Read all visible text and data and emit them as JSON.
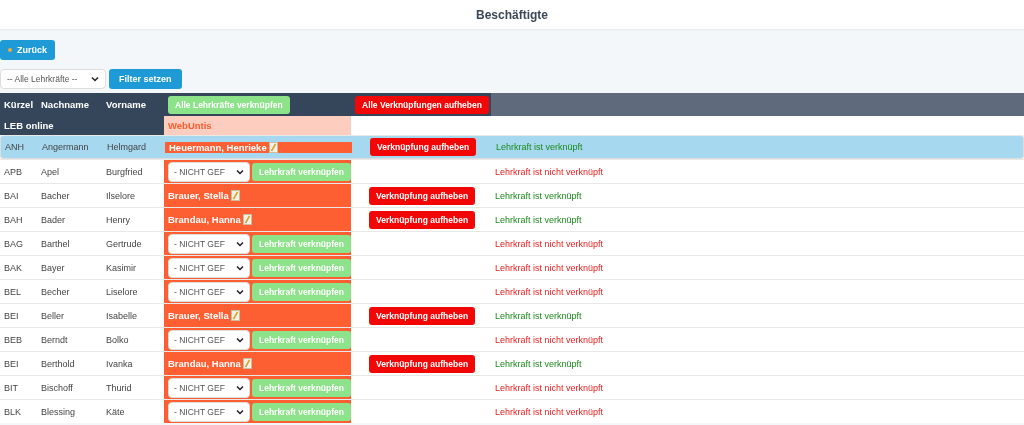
{
  "page_title": "Beschäftigte",
  "back_button": "Zurück",
  "filter": {
    "select_value": "-- Alle Lehrkräfte --",
    "button": "Filter setzen"
  },
  "table": {
    "columns": [
      "Kürzel",
      "Nachname",
      "Vorname"
    ],
    "link_all_button": "Alle Lehrkräfte verknüpfen",
    "unlink_all_button": "Alle Verknüpfungen aufheben",
    "source_label": "LEB online",
    "target_label": "WebUntis",
    "rows": [
      {
        "code": "ANH",
        "last_name": "Angermann",
        "first_name": "Helmgard",
        "selected": true,
        "linked": true,
        "webuntis_name": "Heuermann, Henrieke",
        "action": "Verknüpfung aufheben",
        "status": "Lehrkraft ist verknüpft"
      },
      {
        "code": "APB",
        "last_name": "Apel",
        "first_name": "Burgfried",
        "selected": false,
        "linked": false,
        "select_value": "- NICHT GEF",
        "action": "Lehrkraft verknüpfen",
        "status": "Lehrkraft ist nicht verknüpft"
      },
      {
        "code": "BAI",
        "last_name": "Bacher",
        "first_name": "Ilselore",
        "selected": false,
        "linked": true,
        "webuntis_name": "Brauer, Stella",
        "action": "Verknüpfung aufheben",
        "status": "Lehrkraft ist verknüpft"
      },
      {
        "code": "BAH",
        "last_name": "Bader",
        "first_name": "Henry",
        "selected": false,
        "linked": true,
        "webuntis_name": "Brandau, Hanna",
        "action": "Verknüpfung aufheben",
        "status": "Lehrkraft ist verknüpft"
      },
      {
        "code": "BAG",
        "last_name": "Barthel",
        "first_name": "Gertrude",
        "selected": false,
        "linked": false,
        "select_value": "- NICHT GEF",
        "action": "Lehrkraft verknüpfen",
        "status": "Lehrkraft ist nicht verknüpft"
      },
      {
        "code": "BAK",
        "last_name": "Bayer",
        "first_name": "Kasimir",
        "selected": false,
        "linked": false,
        "select_value": "- NICHT GEF",
        "action": "Lehrkraft verknüpfen",
        "status": "Lehrkraft ist nicht verknüpft"
      },
      {
        "code": "BEL",
        "last_name": "Becher",
        "first_name": "Liselore",
        "selected": false,
        "linked": false,
        "select_value": "- NICHT GEF",
        "action": "Lehrkraft verknüpfen",
        "status": "Lehrkraft ist nicht verknüpft"
      },
      {
        "code": "BEI",
        "last_name": "Beller",
        "first_name": "Isabelle",
        "selected": false,
        "linked": true,
        "webuntis_name": "Brauer, Stella",
        "action": "Verknüpfung aufheben",
        "status": "Lehrkraft ist verknüpft"
      },
      {
        "code": "BEB",
        "last_name": "Berndt",
        "first_name": "Bolko",
        "selected": false,
        "linked": false,
        "select_value": "- NICHT GEF",
        "action": "Lehrkraft verknüpfen",
        "status": "Lehrkraft ist nicht verknüpft"
      },
      {
        "code": "BEI",
        "last_name": "Berthold",
        "first_name": "Ivanka",
        "selected": false,
        "linked": true,
        "webuntis_name": "Brandau, Hanna",
        "action": "Verknüpfung aufheben",
        "status": "Lehrkraft ist verknüpft"
      },
      {
        "code": "BIT",
        "last_name": "Bischoff",
        "first_name": "Thurid",
        "selected": false,
        "linked": false,
        "select_value": "- NICHT GEF",
        "action": "Lehrkraft verknüpfen",
        "status": "Lehrkraft ist nicht verknüpft"
      },
      {
        "code": "BLK",
        "last_name": "Blessing",
        "first_name": "Käte",
        "selected": false,
        "linked": false,
        "select_value": "- NICHT GEF",
        "action": "Lehrkraft verknüpfen",
        "status": "Lehrkraft ist nicht verknüpft"
      }
    ]
  }
}
